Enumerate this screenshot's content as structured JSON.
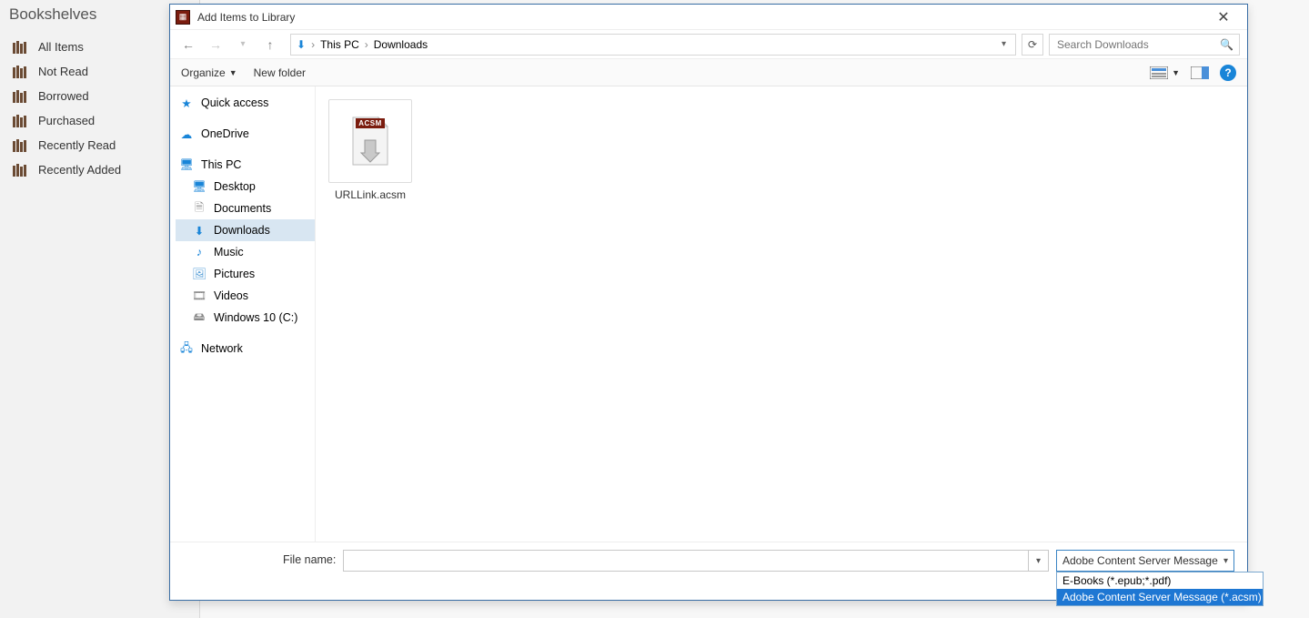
{
  "app_sidebar": {
    "title": "Bookshelves",
    "items": [
      "All Items",
      "Not Read",
      "Borrowed",
      "Purchased",
      "Recently Read",
      "Recently Added"
    ]
  },
  "dialog": {
    "title": "Add Items to Library",
    "nav": {
      "crumbs": [
        "This PC",
        "Downloads"
      ],
      "search_placeholder": "Search Downloads"
    },
    "toolbar": {
      "organize": "Organize",
      "new_folder": "New folder"
    },
    "navpane": {
      "quick_access": "Quick access",
      "onedrive": "OneDrive",
      "this_pc": "This PC",
      "children": [
        "Desktop",
        "Documents",
        "Downloads",
        "Music",
        "Pictures",
        "Videos",
        "Windows 10 (C:)"
      ],
      "selected_child": "Downloads",
      "network": "Network"
    },
    "files": [
      {
        "name": "URLLink.acsm",
        "badge": "ACSM"
      }
    ],
    "footer": {
      "filename_label": "File name:",
      "filename_value": "",
      "filter_selected": "Adobe Content Server Message",
      "filter_options": [
        "E-Books  (*.epub;*.pdf)",
        "Adobe Content Server Message (*.acsm)"
      ],
      "filter_selected_index": 1
    }
  }
}
